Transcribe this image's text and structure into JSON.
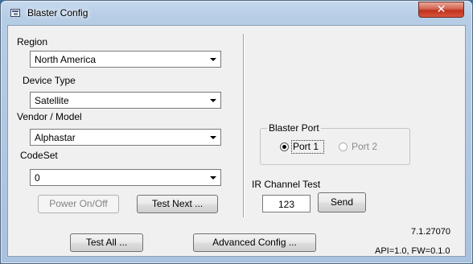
{
  "window": {
    "title": "Blaster Config",
    "close_symbol": "✕"
  },
  "region": {
    "label": "Region",
    "value": "North America"
  },
  "device_type": {
    "label": "Device Type",
    "value": "Satellite"
  },
  "vendor_model": {
    "label": "Vendor / Model",
    "value": "Alphastar"
  },
  "codeset": {
    "label": "CodeSet",
    "value": "0"
  },
  "buttons": {
    "power": "Power On/Off",
    "test_next": "Test Next ...",
    "test_all": "Test All ...",
    "advanced": "Advanced Config ...",
    "send": "Send"
  },
  "blaster_port": {
    "title": "Blaster Port",
    "port1": "Port 1",
    "port2": "Port 2",
    "selected": "Port 1"
  },
  "ir_test": {
    "label": "IR Channel Test",
    "channel": "123"
  },
  "version": {
    "app": "7.1.27070",
    "api_fw": "API=1.0, FW=0.1.0"
  },
  "icons": [
    "window-icon",
    "close-icon",
    "chevron-down-icon",
    "radio-checked-icon",
    "radio-unchecked-icon"
  ]
}
